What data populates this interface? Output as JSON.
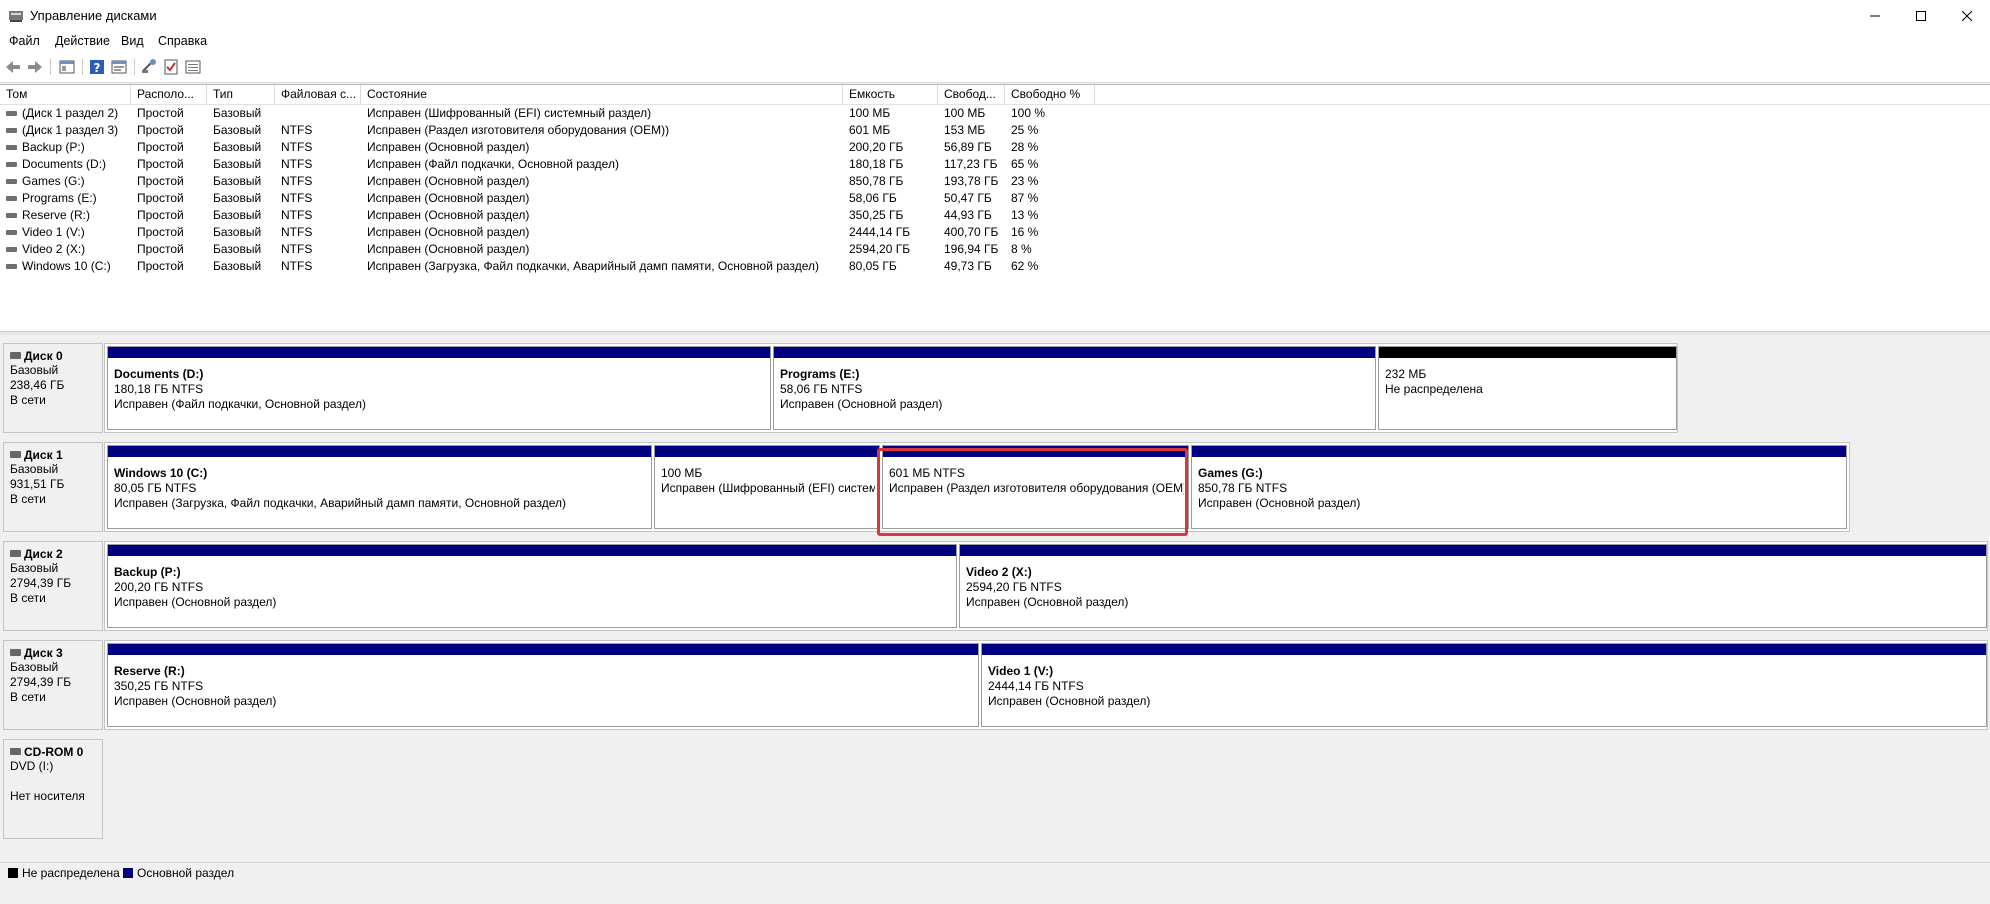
{
  "window": {
    "title": "Управление дисками"
  },
  "menu": [
    "Файл",
    "Действие",
    "Вид",
    "Справка"
  ],
  "toolbar": {
    "buttons": [
      "back-icon",
      "forward-icon",
      "console-tree-icon",
      "help-icon",
      "properties-icon",
      "connect-icon",
      "check-icon",
      "list-view-icon"
    ]
  },
  "columns": [
    "Том",
    "Располо...",
    "Тип",
    "Файловая с...",
    "Состояние",
    "Емкость",
    "Свобод...",
    "Свободно %"
  ],
  "volumes": [
    {
      "name": "(Диск 1 раздел 2)",
      "layout": "Простой",
      "type": "Базовый",
      "fs": "",
      "status": "Исправен (Шифрованный (EFI) системный раздел)",
      "capacity": "100 МБ",
      "free": "100 МБ",
      "pct": "100 %"
    },
    {
      "name": "(Диск 1 раздел 3)",
      "layout": "Простой",
      "type": "Базовый",
      "fs": "NTFS",
      "status": "Исправен (Раздел изготовителя оборудования (OEM))",
      "capacity": "601 МБ",
      "free": "153 МБ",
      "pct": "25 %"
    },
    {
      "name": "Backup (P:)",
      "layout": "Простой",
      "type": "Базовый",
      "fs": "NTFS",
      "status": "Исправен (Основной раздел)",
      "capacity": "200,20 ГБ",
      "free": "56,89 ГБ",
      "pct": "28 %"
    },
    {
      "name": "Documents (D:)",
      "layout": "Простой",
      "type": "Базовый",
      "fs": "NTFS",
      "status": "Исправен (Файл подкачки, Основной раздел)",
      "capacity": "180,18 ГБ",
      "free": "117,23 ГБ",
      "pct": "65 %"
    },
    {
      "name": "Games (G:)",
      "layout": "Простой",
      "type": "Базовый",
      "fs": "NTFS",
      "status": "Исправен (Основной раздел)",
      "capacity": "850,78 ГБ",
      "free": "193,78 ГБ",
      "pct": "23 %"
    },
    {
      "name": "Programs (E:)",
      "layout": "Простой",
      "type": "Базовый",
      "fs": "NTFS",
      "status": "Исправен (Основной раздел)",
      "capacity": "58,06 ГБ",
      "free": "50,47 ГБ",
      "pct": "87 %"
    },
    {
      "name": "Reserve (R:)",
      "layout": "Простой",
      "type": "Базовый",
      "fs": "NTFS",
      "status": "Исправен (Основной раздел)",
      "capacity": "350,25 ГБ",
      "free": "44,93 ГБ",
      "pct": "13 %"
    },
    {
      "name": "Video 1 (V:)",
      "layout": "Простой",
      "type": "Базовый",
      "fs": "NTFS",
      "status": "Исправен (Основной раздел)",
      "capacity": "2444,14 ГБ",
      "free": "400,70 ГБ",
      "pct": "16 %"
    },
    {
      "name": "Video 2 (X:)",
      "layout": "Простой",
      "type": "Базовый",
      "fs": "NTFS",
      "status": "Исправен (Основной раздел)",
      "capacity": "2594,20 ГБ",
      "free": "196,94 ГБ",
      "pct": "8 %"
    },
    {
      "name": "Windows 10 (C:)",
      "layout": "Простой",
      "type": "Базовый",
      "fs": "NTFS",
      "status": "Исправен (Загрузка, Файл подкачки, Аварийный дамп памяти, Основной раздел)",
      "capacity": "80,05 ГБ",
      "free": "49,73 ГБ",
      "pct": "62 %"
    }
  ],
  "disks": [
    {
      "name": "Диск 0",
      "type": "Базовый",
      "size": "238,46 ГБ",
      "state": "В сети",
      "partitions": [
        {
          "title": "Documents  (D:)",
          "size": "180,18 ГБ NTFS",
          "status": "Исправен (Файл подкачки, Основной раздел)",
          "bar": "primary"
        },
        {
          "title": "Programs  (E:)",
          "size": "58,06 ГБ NTFS",
          "status": "Исправен (Основной раздел)",
          "bar": "primary"
        },
        {
          "title": "",
          "size": "232 МБ",
          "status": "Не распределена",
          "bar": "unallocated"
        }
      ]
    },
    {
      "name": "Диск 1",
      "type": "Базовый",
      "size": "931,51 ГБ",
      "state": "В сети",
      "partitions": [
        {
          "title": "Windows 10  (C:)",
          "size": "80,05 ГБ NTFS",
          "status": "Исправен (Загрузка, Файл подкачки, Аварийный дамп памяти, Основной раздел)",
          "bar": "primary"
        },
        {
          "title": "",
          "size": "100 МБ",
          "status": "Исправен (Шифрованный (EFI) систем",
          "bar": "primary"
        },
        {
          "title": "",
          "size": "601 МБ NTFS",
          "status": "Исправен (Раздел изготовителя оборудования (OEM)",
          "bar": "primary"
        },
        {
          "title": "Games  (G:)",
          "size": "850,78 ГБ NTFS",
          "status": "Исправен (Основной раздел)",
          "bar": "primary"
        }
      ]
    },
    {
      "name": "Диск 2",
      "type": "Базовый",
      "size": "2794,39 ГБ",
      "state": "В сети",
      "partitions": [
        {
          "title": "Backup  (P:)",
          "size": "200,20 ГБ NTFS",
          "status": "Исправен (Основной раздел)",
          "bar": "primary"
        },
        {
          "title": "Video 2  (X:)",
          "size": "2594,20 ГБ NTFS",
          "status": "Исправен (Основной раздел)",
          "bar": "primary"
        }
      ]
    },
    {
      "name": "Диск 3",
      "type": "Базовый",
      "size": "2794,39 ГБ",
      "state": "В сети",
      "partitions": [
        {
          "title": "Reserve  (R:)",
          "size": "350,25 ГБ NTFS",
          "status": "Исправен (Основной раздел)",
          "bar": "primary"
        },
        {
          "title": "Video 1  (V:)",
          "size": "2444,14 ГБ NTFS",
          "status": "Исправен (Основной раздел)",
          "bar": "primary"
        }
      ]
    },
    {
      "name": "CD-ROM 0",
      "type": "DVD (I:)",
      "size": "",
      "state": "Нет носителя",
      "partitions": []
    }
  ],
  "legend": [
    {
      "label": "Не распределена",
      "color": "#000000"
    },
    {
      "label": "Основной раздел",
      "color": "#000080"
    }
  ]
}
